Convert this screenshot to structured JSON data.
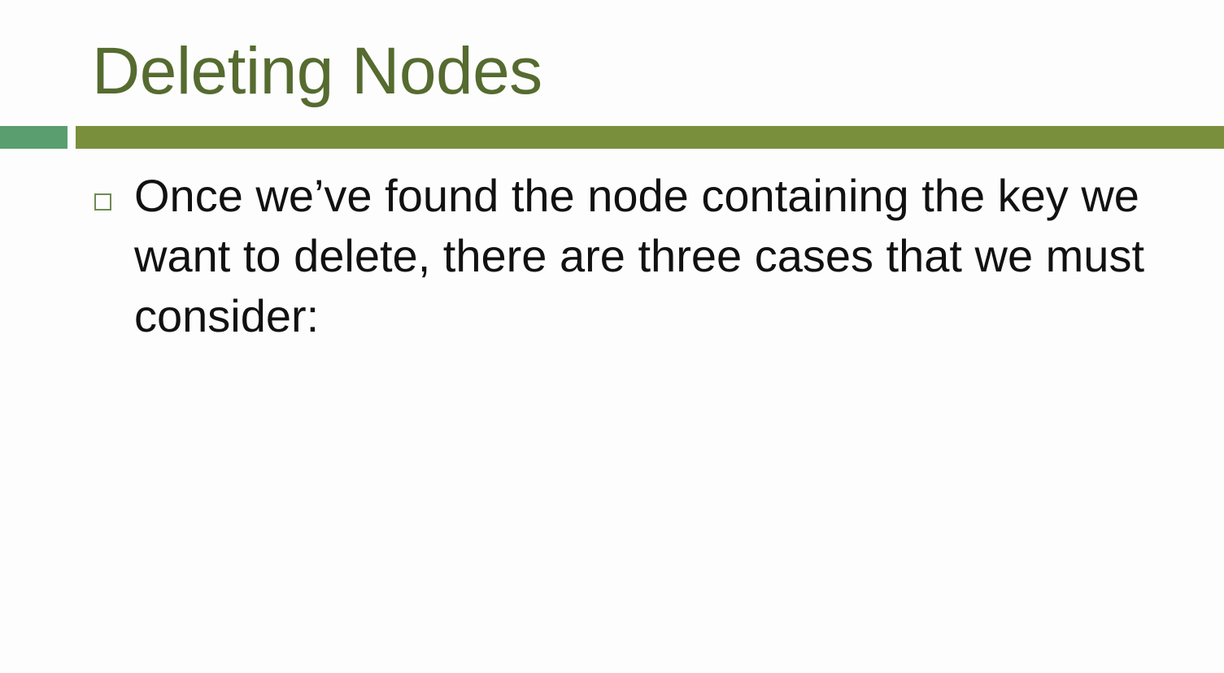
{
  "slide": {
    "title": "Deleting Nodes",
    "bullets": [
      {
        "text": "Once we’ve found the node containing the key we want to delete, there are three cases that we must consider:"
      }
    ]
  },
  "colors": {
    "title": "#556b2f",
    "accent_green": "#5a9e6f",
    "accent_olive": "#7a8f3c",
    "bullet_marker": "#6e8a52",
    "body_text": "#111111",
    "background": "#fdfdfd"
  },
  "icons": {
    "bullet": "hollow-square-bullet-icon"
  }
}
